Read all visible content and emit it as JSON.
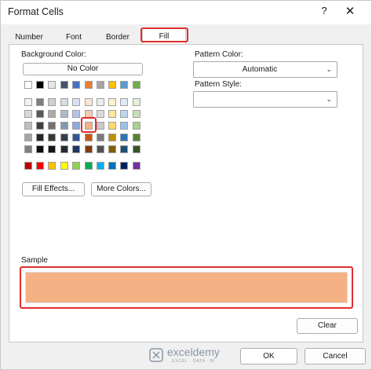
{
  "window": {
    "title": "Format Cells",
    "help_label": "?",
    "close_label": "✕"
  },
  "tabs": [
    {
      "label": "Number",
      "active": false
    },
    {
      "label": "Font",
      "active": false
    },
    {
      "label": "Border",
      "active": false
    },
    {
      "label": "Fill",
      "active": true
    }
  ],
  "fill": {
    "background_color_label": "Background Color:",
    "no_color_label": "No Color",
    "selected_color": "#F4B183",
    "palette": {
      "top_row": [
        "#FFFFFF",
        "#000000",
        "#E7E6E6",
        "#44546A",
        "#4472C4",
        "#ED7D31",
        "#A5A5A5",
        "#FFC000",
        "#5B9BD5",
        "#70AD47"
      ],
      "theme_rows": [
        [
          "#F2F2F2",
          "#7F7F7F",
          "#D0CECE",
          "#D6DCE4",
          "#D9E1F2",
          "#FCE4D6",
          "#EDEDED",
          "#FFF2CC",
          "#DDEBF7",
          "#E2EFDA"
        ],
        [
          "#D9D9D9",
          "#595959",
          "#AEAAAA",
          "#ACB9CA",
          "#B4C6E7",
          "#F8CBAD",
          "#DBDBDB",
          "#FFE699",
          "#BDD7EE",
          "#C6E0B4"
        ],
        [
          "#BFBFBF",
          "#404040",
          "#757171",
          "#8497B0",
          "#8EA9DB",
          "#F4B183",
          "#C9C9C9",
          "#FFD966",
          "#9BC2E6",
          "#A9D08E"
        ],
        [
          "#A6A6A6",
          "#262626",
          "#3A3838",
          "#333F4F",
          "#305496",
          "#C65911",
          "#7B7B7B",
          "#BF8F00",
          "#2F75B5",
          "#548235"
        ],
        [
          "#808080",
          "#0D0D0D",
          "#161616",
          "#222B35",
          "#203764",
          "#833C0C",
          "#525252",
          "#806000",
          "#1F4E78",
          "#375623"
        ]
      ],
      "standard_row": [
        "#C00000",
        "#FF0000",
        "#FFC000",
        "#FFFF00",
        "#92D050",
        "#00B050",
        "#00B0F0",
        "#0070C0",
        "#002060",
        "#7030A0"
      ]
    },
    "fill_effects_label": "Fill Effects...",
    "more_colors_label": "More Colors...",
    "pattern_color_label": "Pattern Color:",
    "pattern_color_value": "Automatic",
    "pattern_style_label": "Pattern Style:",
    "pattern_style_value": ""
  },
  "sample": {
    "label": "Sample"
  },
  "buttons": {
    "clear": "Clear",
    "ok": "OK",
    "cancel": "Cancel"
  },
  "watermark": {
    "name": "exceldemy",
    "tagline": "EXCEL · DATA · BI"
  },
  "colors": {
    "highlight": "#E02D2D",
    "accent": "#F4B183"
  }
}
